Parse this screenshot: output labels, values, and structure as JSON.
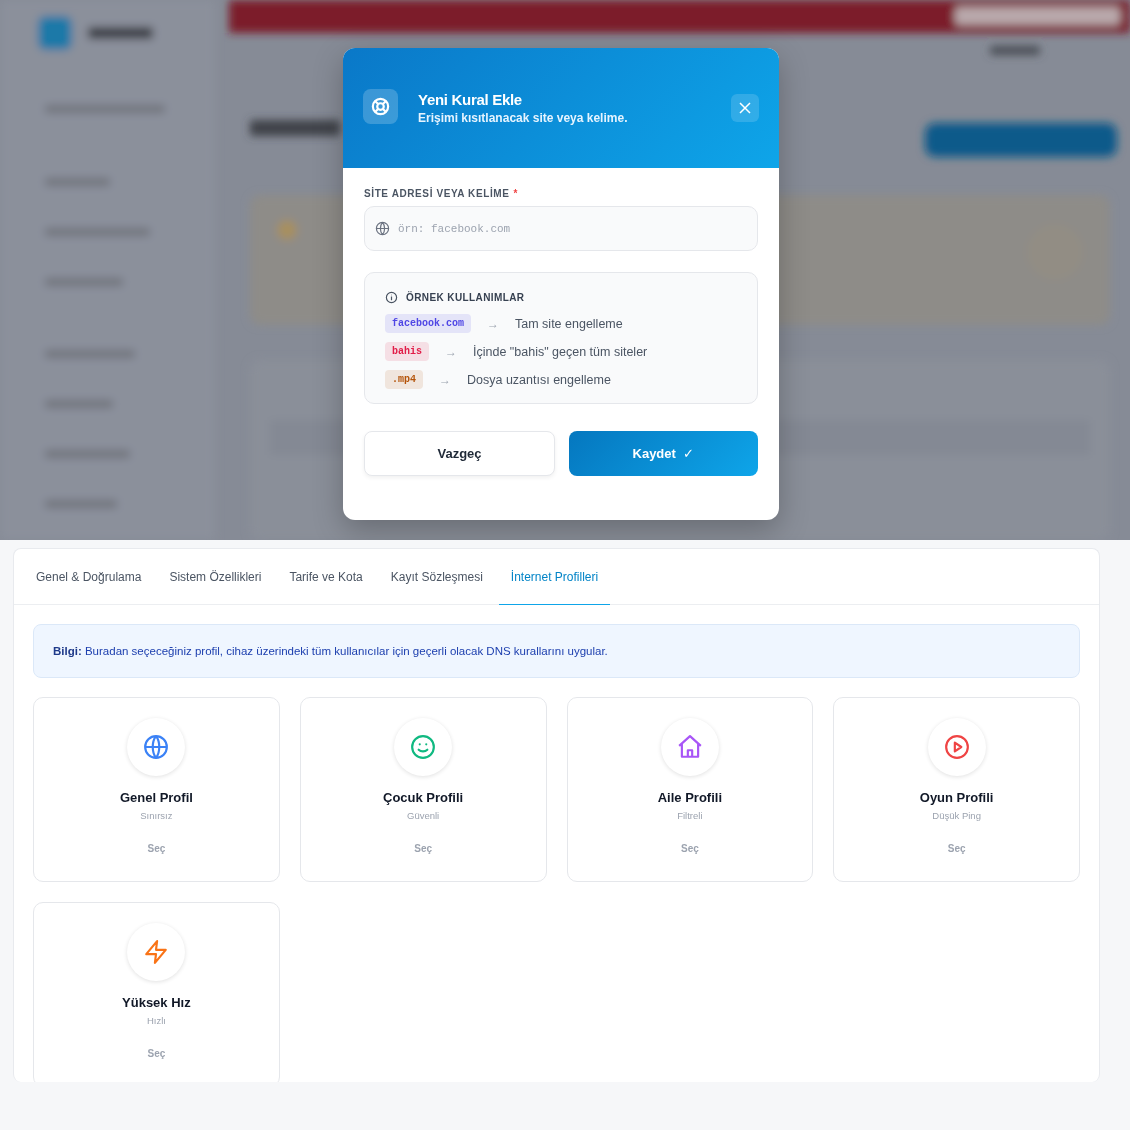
{
  "modal": {
    "title": "Yeni Kural Ekle",
    "subtitle": "Erişimi kısıtlanacak site veya kelime.",
    "field_label": "SİTE ADRESİ VEYA KELİME",
    "required_mark": "*",
    "placeholder": "örn: facebook.com",
    "examples_title": "ÖRNEK KULLANIMLAR",
    "examples": [
      {
        "code": "facebook.com",
        "color": "#4f46e5",
        "arrow": "→",
        "description": "Tam site engelleme"
      },
      {
        "code": "bahis",
        "color": "#e11d48",
        "arrow": "→",
        "description": "İçinde \"bahis\" geçen tüm siteler"
      },
      {
        "code": ".mp4",
        "color": "#b45309",
        "arrow": "→",
        "description": "Dosya uzantısı engelleme"
      }
    ],
    "cancel_button": "Vazgeç",
    "save_button": "Kaydet",
    "save_icon": "✓"
  },
  "tabs": [
    {
      "label": "Genel & Doğrulama",
      "selected": false
    },
    {
      "label": "Sistem Özellikleri",
      "selected": false
    },
    {
      "label": "Tarife ve Kota",
      "selected": false
    },
    {
      "label": "Kayıt Sözleşmesi",
      "selected": false
    },
    {
      "label": "İnternet Profilleri",
      "selected": true
    }
  ],
  "info": "**Bilgi:** Buradan seçeceğiniz profil, cihaz üzerindeki tüm kullanıcılar için geçerli olacak DNS kurallarını uygular.",
  "profiles": [
    {
      "kind": "globe",
      "color": "#3b82f6",
      "name": "Genel Profil",
      "subtitle": "Sınırsız",
      "button": "Seç"
    },
    {
      "kind": "smile",
      "color": "#10b981",
      "name": "Çocuk Profili",
      "subtitle": "Güvenli",
      "button": "Seç"
    },
    {
      "kind": "home",
      "color": "#a855f7",
      "name": "Aile Profili",
      "subtitle": "Filtreli",
      "button": "Seç"
    },
    {
      "kind": "play",
      "color": "#ef4444",
      "name": "Oyun Profili",
      "subtitle": "Düşük Ping",
      "button": "Seç"
    },
    {
      "kind": "bolt",
      "color": "#f97316",
      "name": "Yüksek Hız",
      "subtitle": "Hızlı",
      "button": "Seç"
    }
  ]
}
